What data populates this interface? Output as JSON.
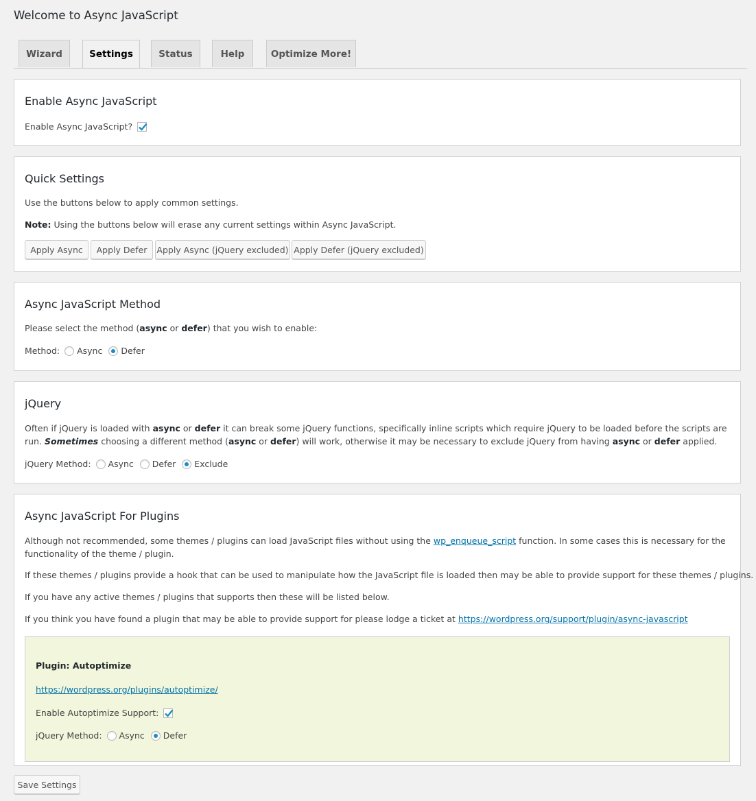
{
  "page": {
    "title": "Welcome to Async JavaScript"
  },
  "tabs": [
    {
      "label": "Wizard",
      "active": false
    },
    {
      "label": "Settings",
      "active": true
    },
    {
      "label": "Status",
      "active": false
    },
    {
      "label": "Help",
      "active": false
    },
    {
      "label": "Optimize More!",
      "active": false
    }
  ],
  "enable_section": {
    "title": "Enable Async JavaScript",
    "checkbox_label": "Enable Async JavaScript?",
    "checked": true
  },
  "quick_settings": {
    "title": "Quick Settings",
    "description": "Use the buttons below to apply common settings.",
    "note_label": "Note:",
    "note_text": " Using the buttons below will erase any current settings within Async JavaScript.",
    "buttons": [
      "Apply Async",
      "Apply Defer",
      "Apply Async (jQuery excluded)",
      "Apply Defer (jQuery excluded)"
    ]
  },
  "method_section": {
    "title": "Async JavaScript Method",
    "desc_1": "Please select the method (",
    "desc_async": "async",
    "desc_or": " or ",
    "desc_defer": "defer",
    "desc_2": ") that you wish to enable:",
    "field_label": "Method:",
    "options": [
      "Async",
      "Defer"
    ],
    "selected": "Defer"
  },
  "jquery_section": {
    "title": "jQuery",
    "p1": "Often if jQuery is loaded with ",
    "p_async": "async",
    "p_or": " or ",
    "p_defer": "defer",
    "p2": " it can break some jQuery functions, specifically inline scripts which require jQuery to be loaded before the scripts are run. ",
    "p_sometimes": "Sometimes",
    "p3": " choosing a different method (",
    "p4": ") will work, otherwise it may be necessary to exclude jQuery from having ",
    "p5": " applied.",
    "field_label": "jQuery Method:",
    "options": [
      "Async",
      "Defer",
      "Exclude"
    ],
    "selected": "Exclude"
  },
  "plugins_section": {
    "title": "Async JavaScript For Plugins",
    "p1_a": "Although not recommended, some themes / plugins can load JavaScript files without using the ",
    "p1_link": "wp_enqueue_script",
    "p1_b": " function. In some cases this is necessary for the functionality of the theme / plugin.",
    "p2": "If these themes / plugins provide a hook that can be used to manipulate how the JavaScript file is loaded then may be able to provide support for these themes / plugins.",
    "p3": "If you have any active themes / plugins that supports then these will be listed below.",
    "p4": "If you think you have found a plugin that may be able to provide support for please lodge a ticket at ",
    "p4_link": "https://wordpress.org/support/plugin/async-javascript",
    "plugin": {
      "title": "Plugin: Autoptimize",
      "link": "https://wordpress.org/plugins/autoptimize/",
      "support_label": "Enable Autoptimize Support:",
      "support_checked": true,
      "field_label": "jQuery Method:",
      "options": [
        "Async",
        "Defer"
      ],
      "selected": "Defer"
    }
  },
  "footer": {
    "save_label": "Save Settings"
  },
  "colors": {
    "accent": "#1e8cbe",
    "link": "#0073aa",
    "plugin_box_bg": "#f2f6dc",
    "page_bg": "#f1f1f1"
  }
}
